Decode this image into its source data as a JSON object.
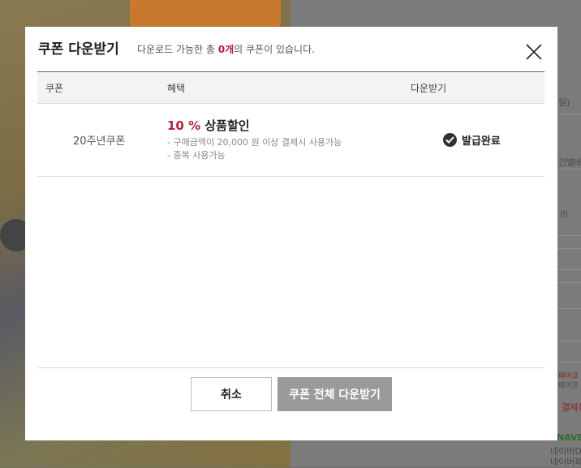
{
  "background": {
    "snippets": [
      "원)",
      "건별배",
      "리",
      "페이코 i",
      "페이코 i",
      "결제하",
      "NAVER",
      "네이버D",
      "네이버페"
    ]
  },
  "modal": {
    "title": "쿠폰 다운받기",
    "subtitle_prefix": "다운로드 가능한 총 ",
    "subtitle_count": "0개",
    "subtitle_suffix": "의 쿠폰이 있습니다.",
    "columns": [
      "쿠폰",
      "혜택",
      "다운받기"
    ],
    "rows": [
      {
        "coupon": "20주년쿠폰",
        "benefit_pct": "10 %",
        "benefit_label": "상품할인",
        "notes": [
          "- 구매금액이 20,000 원 이상 결제시 사용가능",
          "- 중복 사용가능"
        ],
        "status": "발급완료"
      }
    ],
    "buttons": {
      "cancel": "취소",
      "download_all": "쿠폰 전체 다운받기"
    }
  }
}
